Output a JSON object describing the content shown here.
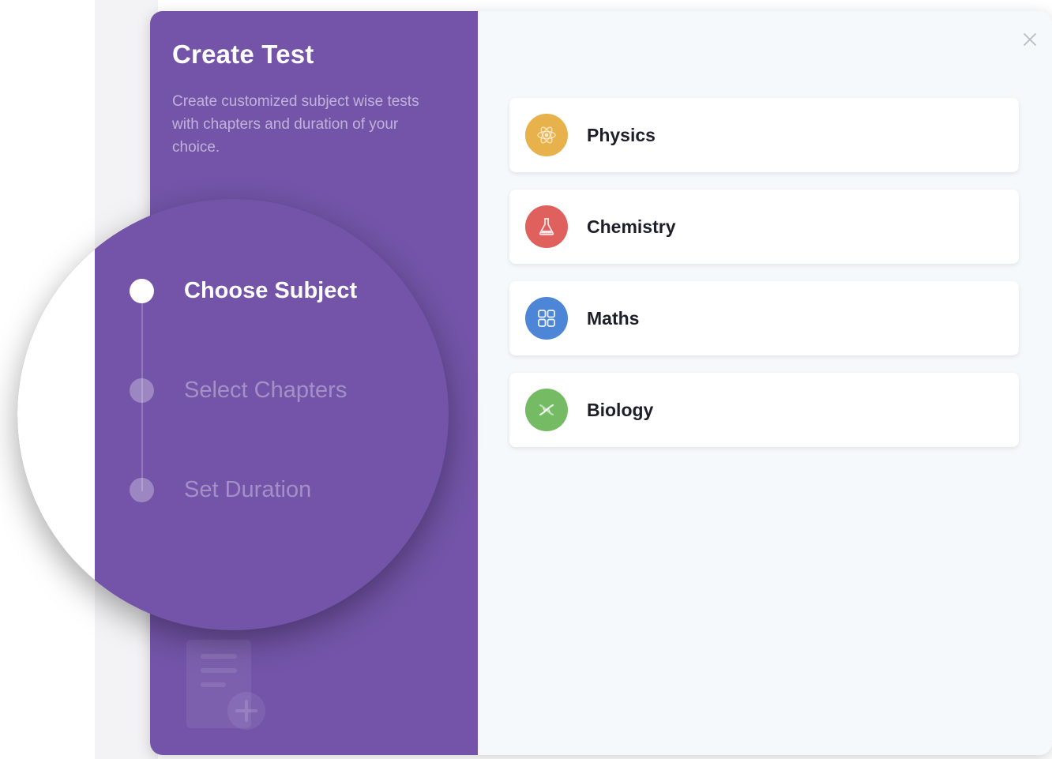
{
  "dialog": {
    "title": "Create Test",
    "description": "Create customized subject wise tests with chapters and duration of your choice.",
    "close_icon": "close-icon"
  },
  "steps": [
    {
      "label": "Choose Subject",
      "active": true
    },
    {
      "label": "Select Chapters",
      "active": false
    },
    {
      "label": "Set Duration",
      "active": false
    }
  ],
  "subjects": [
    {
      "label": "Physics",
      "icon": "atom-icon",
      "color": "#e7b24b"
    },
    {
      "label": "Chemistry",
      "icon": "flask-icon",
      "color": "#e0605d"
    },
    {
      "label": "Maths",
      "icon": "calculator-icon",
      "color": "#4d86d6"
    },
    {
      "label": "Biology",
      "icon": "dna-icon",
      "color": "#74bb63"
    }
  ],
  "colors": {
    "panel_purple": "#7354a8",
    "content_background": "#f6f9fc",
    "card_background": "#ffffff",
    "text_dark": "#1e1e2a"
  }
}
